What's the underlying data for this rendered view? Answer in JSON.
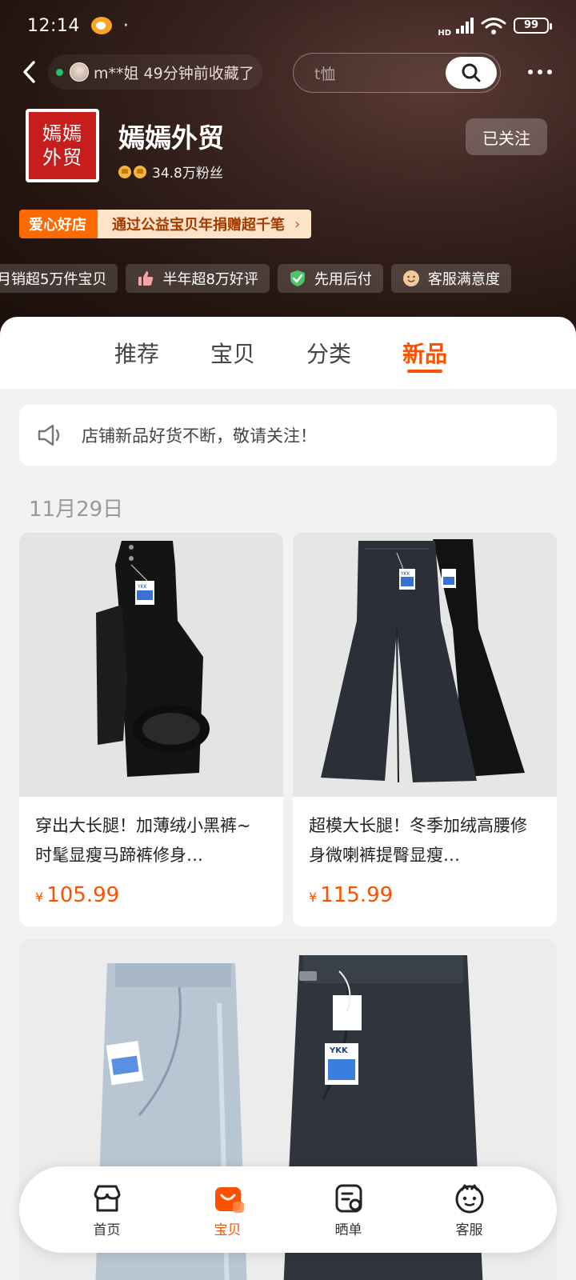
{
  "status_bar": {
    "time": "12:14",
    "dot": "·",
    "network": "HD",
    "battery": "99"
  },
  "nav": {
    "visitor_text": "m**姐 49分钟前收藏了",
    "search_placeholder": "t恤",
    "icons": [
      "back-icon",
      "search-icon",
      "more-icon"
    ]
  },
  "shop": {
    "logo_line1": "嫣嫣",
    "logo_line2": "外贸",
    "name": "嫣嫣外贸",
    "fans": "34.8万粉丝",
    "follow_label": "已关注",
    "charity_badge": "爱心好店",
    "charity_text": "通过公益宝贝年捐赠超千笔",
    "badges": [
      {
        "icon": "bag-icon",
        "label": "月销超5万件宝贝"
      },
      {
        "icon": "thumbs-up-icon",
        "label": "半年超8万好评"
      },
      {
        "icon": "shield-check-icon",
        "label": "先用后付"
      },
      {
        "icon": "smile-icon",
        "label": "客服满意度"
      }
    ]
  },
  "tabs": [
    {
      "label": "推荐",
      "active": false
    },
    {
      "label": "宝贝",
      "active": false
    },
    {
      "label": "分类",
      "active": false
    },
    {
      "label": "新品",
      "active": true
    }
  ],
  "notice": {
    "icon": "speaker-icon",
    "text": "店铺新品好货不断，敬请关注！"
  },
  "date_label": "11月29日",
  "products": [
    {
      "title": "穿出大长腿！加薄绒小黑裤~时髦显瘦马蹄裤修身…",
      "currency": "¥",
      "price": "105.99",
      "tag": "YKK"
    },
    {
      "title": "超模大长腿！冬季加绒高腰修身微喇裤提臀显瘦…",
      "currency": "¥",
      "price": "115.99",
      "tag": "YKK"
    }
  ],
  "big_card_tag": "YKK",
  "bottom_nav": [
    {
      "icon": "shop-icon",
      "label": "首页",
      "active": false
    },
    {
      "icon": "bag-icon",
      "label": "宝贝",
      "active": true
    },
    {
      "icon": "list-icon",
      "label": "晒单",
      "active": false
    },
    {
      "icon": "service-icon",
      "label": "客服",
      "active": false
    }
  ],
  "colors": {
    "accent": "#ff5000",
    "header_bg": "#24150f",
    "charity_orange": "#ff6a00"
  }
}
